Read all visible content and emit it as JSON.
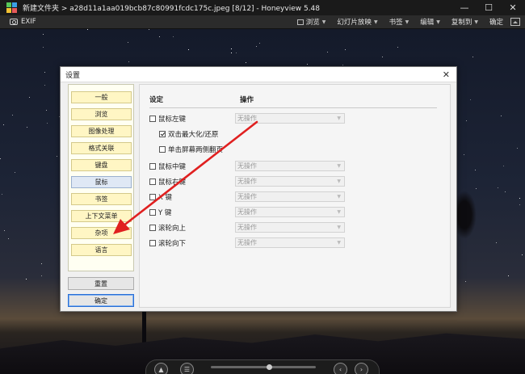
{
  "window": {
    "title": "新建文件夹 > a28d11a1aa019bcb87c80991fcdc175c.jpeg [8/12] - Honeyview 5.48",
    "controls": [
      "—",
      "☐",
      "✕"
    ]
  },
  "toolbar": {
    "exif_label": "EXIF",
    "items": [
      {
        "label": "浏览"
      },
      {
        "label": "幻灯片放映"
      },
      {
        "label": "书签"
      },
      {
        "label": "编辑"
      },
      {
        "label": "复制到"
      },
      {
        "label": "确定"
      }
    ]
  },
  "dialog": {
    "title": "设置",
    "close": "✕",
    "categories": [
      {
        "label": "一般",
        "active": false
      },
      {
        "label": "浏览",
        "active": false
      },
      {
        "label": "图像处理",
        "active": false
      },
      {
        "label": "格式关联",
        "active": false
      },
      {
        "label": "键盘",
        "active": false
      },
      {
        "label": "鼠标",
        "active": true
      },
      {
        "label": "书签",
        "active": false
      },
      {
        "label": "上下文菜单",
        "active": false
      },
      {
        "label": "杂项",
        "active": false
      },
      {
        "label": "语言",
        "active": false
      }
    ],
    "apply_label": "重置",
    "ok_label": "确定",
    "headers": {
      "setting": "设定",
      "action": "操作"
    },
    "rows": [
      {
        "label": "鼠标左键",
        "checked": false,
        "action": "无操作",
        "indent": 0
      },
      {
        "label": "双击最大化/还原",
        "checked": true,
        "action": "",
        "indent": 1
      },
      {
        "label": "单击屏幕两侧翻页",
        "checked": false,
        "action": "",
        "indent": 1
      },
      {
        "label": "鼠标中键",
        "checked": false,
        "action": "无操作",
        "indent": 0
      },
      {
        "label": "鼠标右键",
        "checked": false,
        "action": "无操作",
        "indent": 0
      },
      {
        "label": "X 键",
        "checked": false,
        "action": "无操作",
        "indent": 0
      },
      {
        "label": "Y 键",
        "checked": false,
        "action": "无操作",
        "indent": 0
      },
      {
        "label": "滚轮向上",
        "checked": false,
        "action": "无操作",
        "indent": 0
      },
      {
        "label": "滚轮向下",
        "checked": false,
        "action": "无操作",
        "indent": 0
      }
    ]
  },
  "navbar": {
    "buttons": [
      "▲",
      "☰",
      "‹",
      "›"
    ],
    "slider_position": 0.55
  },
  "colors": {
    "annotation_arrow": "#e02020",
    "active_category": "#dfe8f5",
    "category_bg": "#fff6c4"
  }
}
